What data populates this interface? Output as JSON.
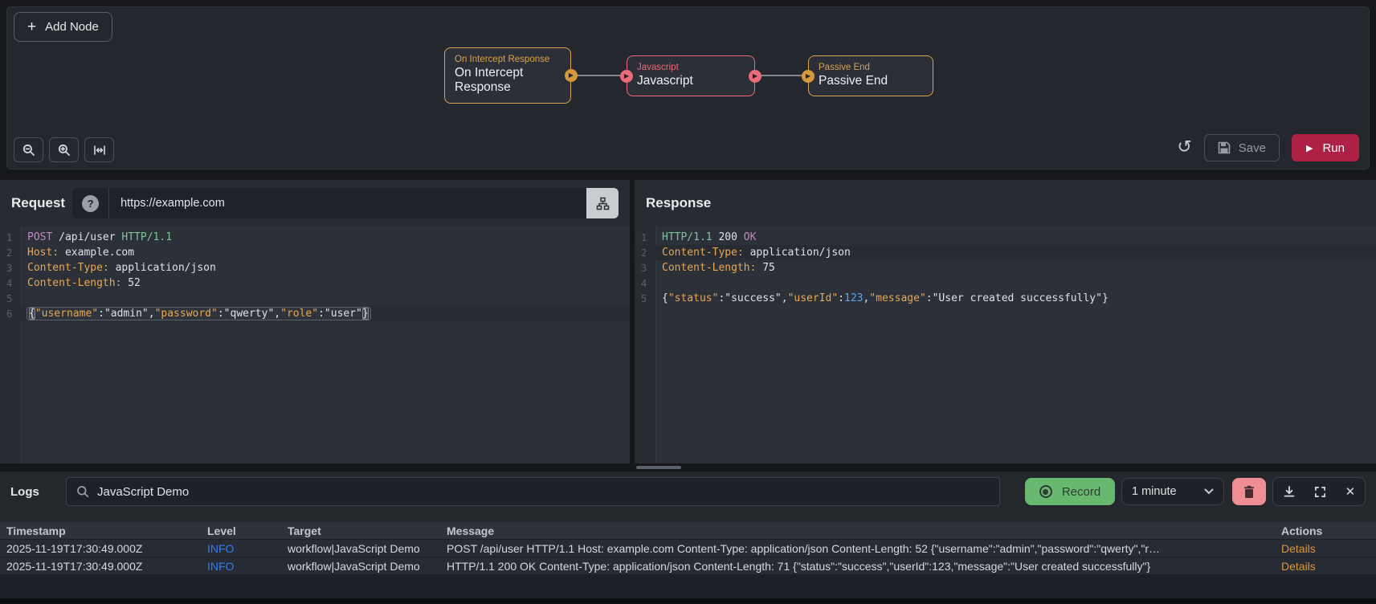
{
  "colors": {
    "run_red": "#ae2145",
    "record_green": "#69b870",
    "trash_pink": "#ef8f93",
    "info_blue": "#2f7dff",
    "details_orange": "#d9973f",
    "node_amber": "#d7a54b",
    "node_pink": "#ec6a78"
  },
  "canvas": {
    "add_node_label": "Add Node",
    "nodes": [
      {
        "type_label": "On Intercept Response",
        "title": "On Intercept Response",
        "color": "amber",
        "ports": "out"
      },
      {
        "type_label": "Javascript",
        "title": "Javascript",
        "color": "pink",
        "ports": "both"
      },
      {
        "type_label": "Passive End",
        "title": "Passive End",
        "color": "amber",
        "ports": "in"
      }
    ],
    "toolbar": {
      "save_label": "Save",
      "run_label": "Run"
    }
  },
  "request": {
    "title": "Request",
    "url": "https://example.com",
    "active_line": 6,
    "boxed_active": true,
    "lines": [
      [
        [
          "m",
          "POST"
        ],
        [
          "t",
          " /api/user "
        ],
        [
          "v",
          "HTTP/1.1"
        ]
      ],
      [
        [
          "k",
          "Host:"
        ],
        [
          "t",
          " example.com"
        ]
      ],
      [
        [
          "k",
          "Content-Type:"
        ],
        [
          "t",
          " application/json"
        ]
      ],
      [
        [
          "k",
          "Content-Length:"
        ],
        [
          "t",
          " 52"
        ]
      ],
      [],
      [
        [
          "b",
          "{"
        ],
        [
          "k",
          "\"username\""
        ],
        [
          "t",
          ":"
        ],
        [
          "s",
          "\"admin\""
        ],
        [
          "t",
          ","
        ],
        [
          "k",
          "\"password\""
        ],
        [
          "t",
          ":"
        ],
        [
          "s",
          "\"qwerty\""
        ],
        [
          "t",
          ","
        ],
        [
          "k",
          "\"role\""
        ],
        [
          "t",
          ":"
        ],
        [
          "s",
          "\"user\""
        ],
        [
          "b",
          "}"
        ]
      ]
    ]
  },
  "response": {
    "title": "Response",
    "active_line": 2,
    "boxed_active": false,
    "lines": [
      [
        [
          "v",
          "HTTP/1.1"
        ],
        [
          "t",
          " 200 "
        ],
        [
          "r",
          "OK"
        ]
      ],
      [
        [
          "k",
          "Content-Type:"
        ],
        [
          "t",
          " application/json"
        ]
      ],
      [
        [
          "k",
          "Content-Length:"
        ],
        [
          "t",
          " 75"
        ]
      ],
      [],
      [
        [
          "t",
          "{"
        ],
        [
          "k",
          "\"status\""
        ],
        [
          "t",
          ":"
        ],
        [
          "s",
          "\"success\""
        ],
        [
          "t",
          ","
        ],
        [
          "k",
          "\"userId\""
        ],
        [
          "t",
          ":"
        ],
        [
          "n",
          "123"
        ],
        [
          "t",
          ","
        ],
        [
          "k",
          "\"message\""
        ],
        [
          "t",
          ":"
        ],
        [
          "s",
          "\"User created successfully\""
        ],
        [
          "t",
          "}"
        ]
      ]
    ]
  },
  "logs": {
    "title": "Logs",
    "search_value": "JavaScript Demo",
    "record_label": "Record",
    "interval_value": "1 minute",
    "table": {
      "headers": [
        "Timestamp",
        "Level",
        "Target",
        "Message",
        "Actions"
      ],
      "rows": [
        {
          "timestamp": "2025-11-19T17:30:49.000Z",
          "level": "INFO",
          "target": "workflow|JavaScript Demo",
          "message": "POST /api/user HTTP/1.1 Host: example.com Content-Type: application/json Content-Length: 52 {\"username\":\"admin\",\"password\":\"qwerty\",\"r…",
          "action": "Details"
        },
        {
          "timestamp": "2025-11-19T17:30:49.000Z",
          "level": "INFO",
          "target": "workflow|JavaScript Demo",
          "message": "HTTP/1.1 200 OK Content-Type: application/json Content-Length: 71 {\"status\":\"success\",\"userId\":123,\"message\":\"User created successfully\"}",
          "action": "Details"
        }
      ]
    }
  }
}
